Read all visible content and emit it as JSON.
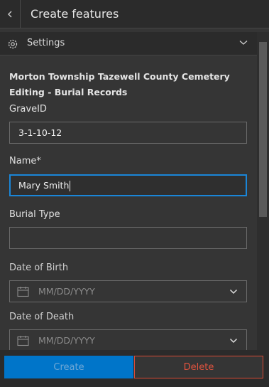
{
  "header": {
    "title": "Create features",
    "back_icon": "chevron-left-icon"
  },
  "settings": {
    "label": "Settings",
    "icon": "gear-icon",
    "expand_icon": "chevron-down-icon"
  },
  "form": {
    "title": "Morton Township Tazewell County Cemetery Editing - Burial Records",
    "fields": [
      {
        "label": "GraveID",
        "value": "3-1-10-12"
      },
      {
        "label": "Name*",
        "value": "Mary Smith"
      },
      {
        "label": "Burial Type",
        "value": ""
      },
      {
        "label": "Date of Birth",
        "placeholder": "MM/DD/YYYY"
      },
      {
        "label": "Date of Death",
        "placeholder": "MM/DD/YYYY"
      }
    ]
  },
  "footer": {
    "create_label": "Create",
    "delete_label": "Delete"
  },
  "colors": {
    "accent": "#0075c9",
    "danger": "#d94a35",
    "background": "#353535"
  }
}
